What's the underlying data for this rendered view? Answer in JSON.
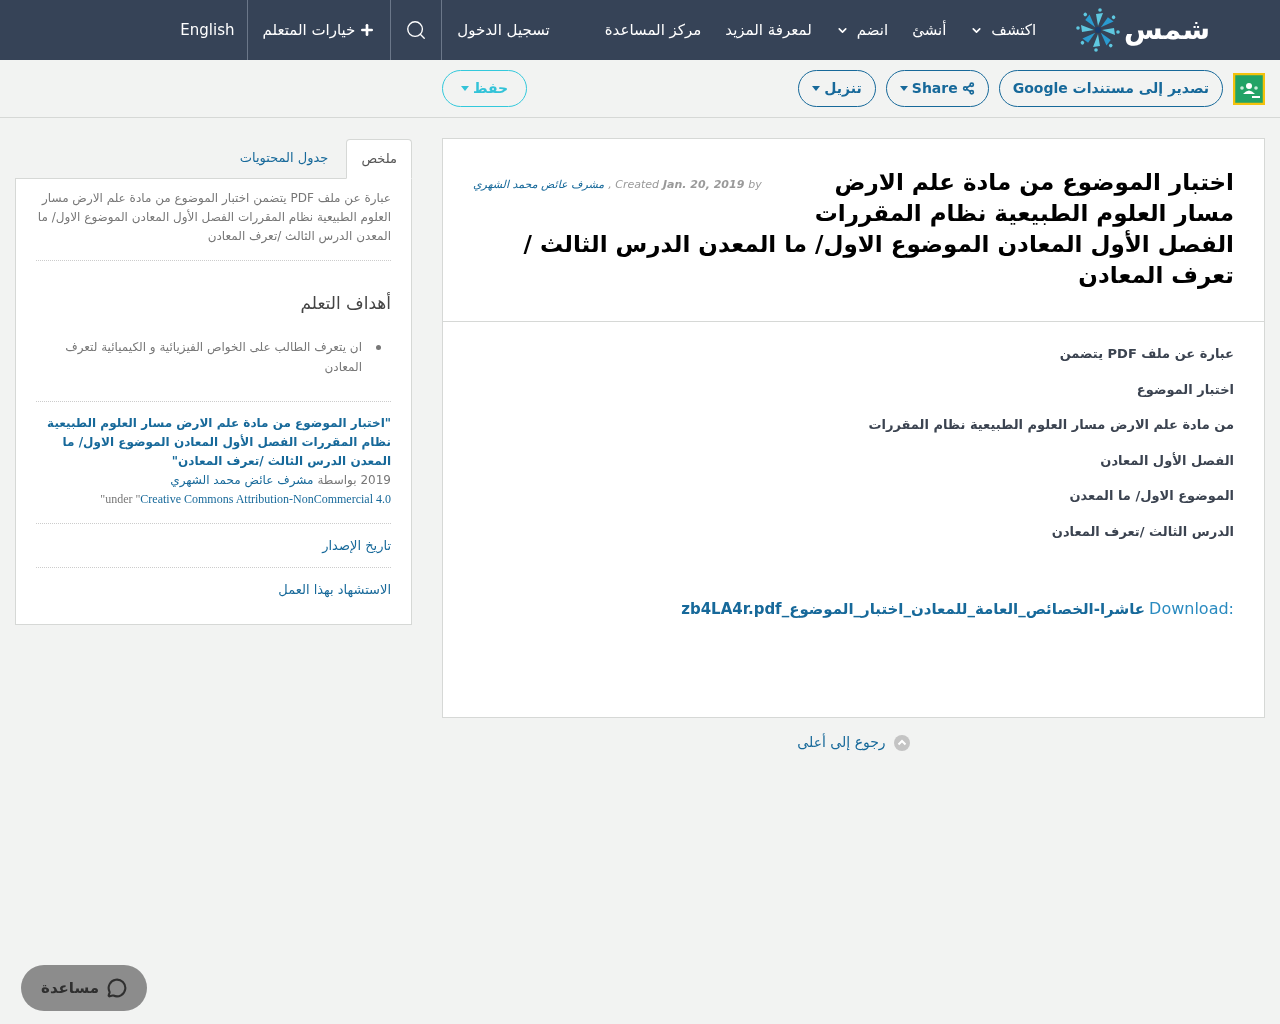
{
  "header": {
    "logo_text": "شمس",
    "nav": [
      {
        "label": "اكتشف",
        "kind": "dropdown"
      },
      {
        "label": "أنشئ",
        "kind": "link"
      },
      {
        "label": "انضم",
        "kind": "dropdown"
      },
      {
        "label": "لمعرفة المزيد",
        "kind": "link"
      },
      {
        "label": "مركز المساعدة",
        "kind": "link"
      }
    ],
    "login": "تسجيل الدخول",
    "learner_options": "خيارات المتعلم",
    "language": "English"
  },
  "toolbar": {
    "buttons": [
      {
        "label": "تصدير إلى مستندات Google",
        "kind": "plain"
      },
      {
        "label": "Share",
        "kind": "share"
      },
      {
        "label": "تنزيل",
        "kind": "dropdown"
      }
    ],
    "save": "حفظ"
  },
  "article": {
    "title_lines": [
      "اختبار الموضوع من مادة علم الارض",
      "مسار العلوم الطبيعية نظام المقررات",
      "الفصل الأول المعادن الموضوع الاول/ ما المعدن الدرس الثالث /",
      "تعرف المعادن"
    ],
    "meta": {
      "by": "by",
      "date": "Jan. 20, 2019",
      "created": ", Created",
      "author": "مشرف عائض محمد الشهري"
    },
    "paragraphs": [
      "عبارة عن ملف PDF  يتضمن",
      "اختبار الموضوع",
      "من مادة علم الارض مسار العلوم الطبيعية نظام المقررات",
      "الفصل الأول المعادن",
      "الموضوع الاول/ ما المعدن",
      "الدرس الثالث /تعرف المعادن"
    ],
    "download": {
      "label": "Download:",
      "file": "عاشرا-الخصائص_العامة_للمعادن_اختبار_الموضوع_zb4LA4r.pdf"
    }
  },
  "back_to_top": "رجوع إلى أعلى",
  "sidebar": {
    "tabs": [
      {
        "label": "ملخص",
        "selected": true
      },
      {
        "label": "جدول المحتويات",
        "selected": false
      }
    ],
    "summary": "عبارة عن ملف PDF يتضمن اختبار الموضوع من مادة علم الارض مسار العلوم الطبيعية نظام المقررات الفصل الأول المعادن الموضوع الاول/ ما المعدن الدرس الثالث /تعرف المعادن",
    "objectives_heading": "أهداف التعلم",
    "objectives": [
      "ان يتعرف الطالب على الخواص الفيزيائية و الكيميائية لتعرف المعادن"
    ],
    "citation": {
      "title": "\"اختبار الموضوع من مادة علم الارض مسار العلوم الطبيعية نظام المقررات الفصل الأول المعادن الموضوع الاول/ ما المعدن الدرس الثالث /تعرف المعادن\"",
      "by": "2019 بواسطة",
      "author": "مشرف عائض محمد الشهري",
      "license_prefix": "\"under \"",
      "license": "Creative Commons Attribution-NonCommercial 4.0"
    },
    "links": [
      "تاريخ الإصدار",
      "الاستشهاد بهذا العمل"
    ]
  },
  "help_button": "مساعدة"
}
